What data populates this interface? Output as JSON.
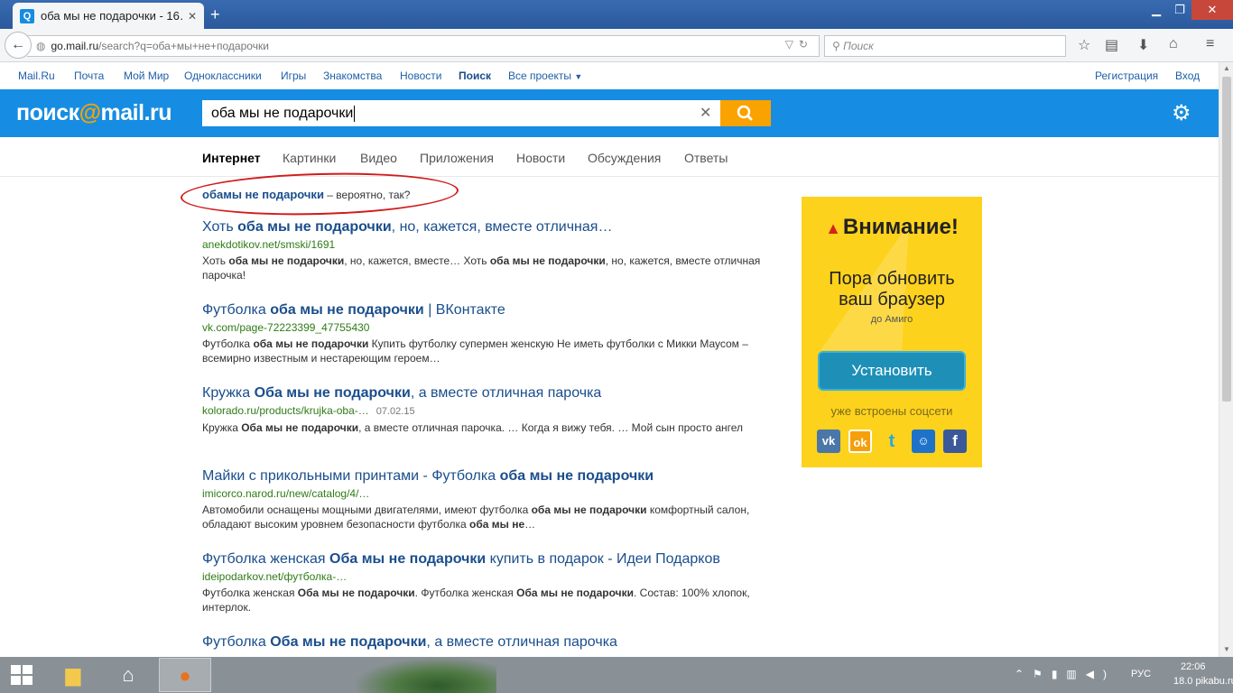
{
  "browser": {
    "tab_title": "оба мы не подарочки - 16…",
    "tab_icon": "Q",
    "new_tab": "+",
    "url_domain": "go.mail.ru",
    "url_path": "/search?q=оба+мы+не+подарочки",
    "search_placeholder": "Поиск"
  },
  "toplinks": {
    "mailru": "Mail.Ru",
    "pochta": "Почта",
    "moimir": "Мой Мир",
    "odnoklassniki": "Одноклассники",
    "igry": "Игры",
    "znakomstva": "Знакомства",
    "novosti": "Новости",
    "poisk": "Поиск",
    "vse_proekty": "Все проекты",
    "registration": "Регистрация",
    "login": "Вход"
  },
  "header": {
    "logo_left": "поиск",
    "logo_at": "@",
    "logo_right": "mail.ru",
    "query": "оба мы не подарочки"
  },
  "vtabs": {
    "internet": "Интернет",
    "images": "Картинки",
    "video": "Видео",
    "apps": "Приложения",
    "news": "Новости",
    "discussions": "Обсуждения",
    "answers": "Ответы"
  },
  "correction": {
    "suggestion": "обамы не подарочки",
    "tail": " – вероятно, так?"
  },
  "results": [
    {
      "t1": "Хоть ",
      "t2": "оба мы не подарочки",
      "t3": ", но, кажется, вместе отличная…",
      "url": "anekdotikov.net/smski/1691",
      "date": "",
      "s1": "Хоть ",
      "s2": "оба мы не подарочки",
      "s3": ", но, кажется, вместе… Хоть ",
      "s4": "оба мы не подарочки",
      "s5": ", но, кажется, вместе отличная парочка!"
    },
    {
      "t1": "Футболка ",
      "t2": "оба мы не подарочки",
      "t3": " | ВКонтакте",
      "url": "vk.com/page-72223399_47755430",
      "date": "",
      "s1": "Футболка ",
      "s2": "оба мы не подарочки",
      "s3": " Купить футболку супермен женскую Не иметь футболки с Микки Маусом – всемирно известным и нестареющим героем…",
      "s4": "",
      "s5": ""
    },
    {
      "t1": "Кружка ",
      "t2": "Оба мы не подарочки",
      "t3": ", а вместе отличная парочка",
      "url": "kolorado.ru/products/krujka-oba-…",
      "date": "07.02.15",
      "s1": "Кружка ",
      "s2": "Оба мы не подарочки",
      "s3": ", а вместе отличная парочка. … Когда я вижу тебя. … Мой сын просто ангел",
      "s4": "",
      "s5": ""
    },
    {
      "t1": "Майки с прикольными принтами - Футболка ",
      "t2": "оба мы не подарочки",
      "t3": "",
      "url": "imicorco.narod.ru/new/catalog/4/…",
      "date": "",
      "s1": "Автомобили оснащены мощными двигателями, имеют футболка ",
      "s2": "оба мы не подарочки",
      "s3": " комфортный салон, обладают высоким уровнем безопасности футболка ",
      "s4": "оба мы не",
      "s5": "…"
    },
    {
      "t1": "Футболка женская ",
      "t2": "Оба мы не подарочки",
      "t3": " купить в подарок - Идеи Подарков",
      "url": "ideipodarkov.net/футболка-…",
      "date": "",
      "s1": "Футболка женская ",
      "s2": "Оба мы не подарочки",
      "s3": ". Футболка женская ",
      "s4": "Оба мы не подарочки",
      "s5": ". Состав: 100% хлопок, интерлок."
    },
    {
      "t1": "Футболка ",
      "t2": "Оба мы не подарочки",
      "t3": ", а вместе отличная парочка",
      "url": "",
      "date": "",
      "s1": "",
      "s2": "",
      "s3": "",
      "s4": "",
      "s5": ""
    }
  ],
  "ad": {
    "warning_symbol": "▲",
    "title": "Внимание!",
    "line1": "Пора обновить",
    "line2": "ваш браузер",
    "sub": "до Амиго",
    "install": "Установить",
    "social_text": "уже встроены соцсети",
    "vk": "vk",
    "ok": "ok",
    "tw": "t",
    "mm": "☺",
    "fb": "f"
  },
  "taskbar": {
    "lang": "РУС",
    "time": "22:06",
    "date": "18.0",
    "watermark": "pikabu.ru"
  },
  "colors": {
    "header_blue": "#168de2",
    "search_orange": "#f9a200",
    "link_blue": "#1a4e8c",
    "url_green": "#2e7b16",
    "ad_yellow": "#fdd21d",
    "annotation_red": "#d11b1b"
  }
}
